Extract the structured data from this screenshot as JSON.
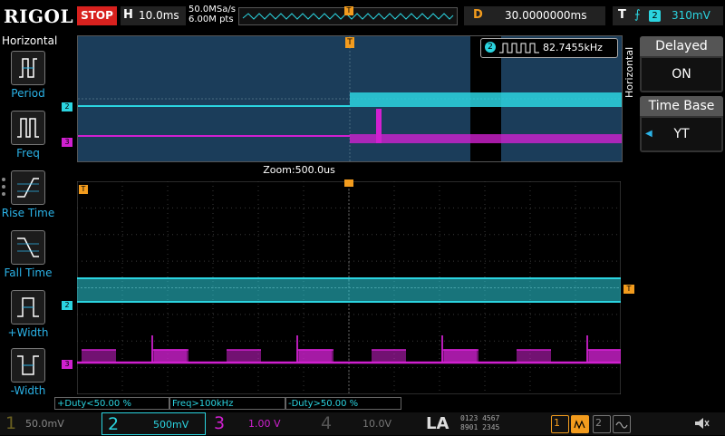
{
  "top": {
    "logo": "RIGOL",
    "run_state": "STOP",
    "h_label": "H",
    "timebase": "10.0ms",
    "sample_rate": "50.0MSa/s",
    "memory_depth": "6.00M pts",
    "delay_label": "D",
    "delay_value": "30.0000000ms",
    "trigger_label": "T",
    "trigger_edge": "rising-edge-icon",
    "trigger_channel": "2",
    "trigger_level": "310mV"
  },
  "left_menu": {
    "title": "Horizontal",
    "items": [
      {
        "label": "Period",
        "icon": "period-icon"
      },
      {
        "label": "Freq",
        "icon": "freq-icon"
      },
      {
        "label": "Rise Time",
        "icon": "rise-time-icon"
      },
      {
        "label": "Fall Time",
        "icon": "fall-time-icon"
      },
      {
        "label": "+Width",
        "icon": "positive-width-icon"
      },
      {
        "label": "-Width",
        "icon": "negative-width-icon"
      }
    ]
  },
  "overview": {
    "freq_channel": "2",
    "freq_value": "82.7455kHz",
    "zoom_label": "Zoom:500.0us"
  },
  "right_panel": {
    "side_label": "Horizontal",
    "delayed_label": "Delayed",
    "delayed_value": "ON",
    "timebase_label": "Time Base",
    "timebase_value": "YT"
  },
  "measurements": [
    {
      "text": "+Duty<50.00 %"
    },
    {
      "text": "Freq>100kHz"
    },
    {
      "text": "-Duty>50.00 %"
    }
  ],
  "channels": [
    {
      "num": "1",
      "scale": "50.0mV",
      "color": "#b0a020"
    },
    {
      "num": "2",
      "scale": "500mV",
      "color": "#2bd4e0"
    },
    {
      "num": "3",
      "scale": "1.00 V",
      "color": "#d020d0"
    },
    {
      "num": "4",
      "scale": "10.0V",
      "color": "#2060e0"
    }
  ],
  "bottom": {
    "la": "LA",
    "la_digits_row1": "0123 4567",
    "la_digits_row2": "8901 2345",
    "math1": "1",
    "math2": "2",
    "speaker_icon": "speaker-mute-icon"
  },
  "colors": {
    "ch2": "#2bd4e0",
    "ch3": "#d020d0",
    "trigger": "#f39c1e",
    "stop": "#d8211e"
  }
}
